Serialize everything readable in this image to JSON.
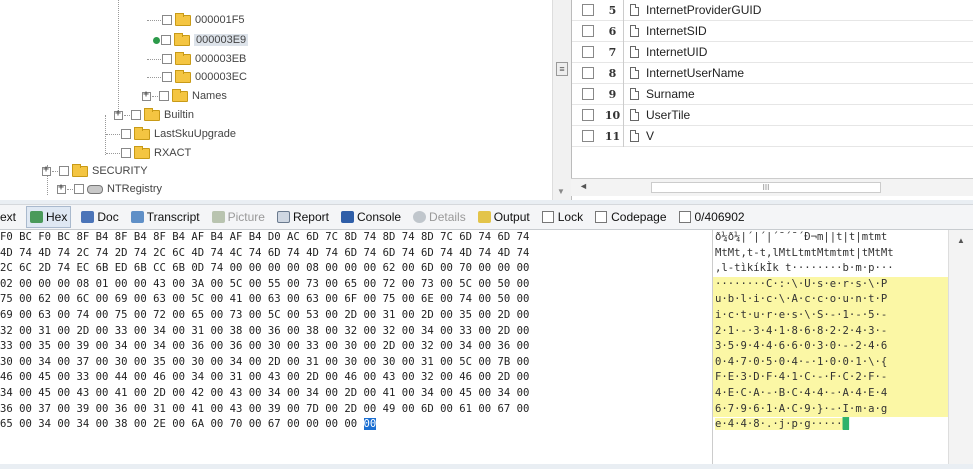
{
  "tree": {
    "items": [
      {
        "label": "000001F5",
        "selected": false
      },
      {
        "label": "000003E9",
        "selected": true
      },
      {
        "label": "000003EB",
        "selected": false
      },
      {
        "label": "000003EC",
        "selected": false
      },
      {
        "label": "Names",
        "selected": false
      },
      {
        "label": "Builtin",
        "selected": false
      },
      {
        "label": "LastSkuUpgrade",
        "selected": false
      },
      {
        "label": "RXACT",
        "selected": false
      },
      {
        "label": "SECURITY",
        "selected": false
      },
      {
        "label": "NTRegistry",
        "selected": false
      }
    ]
  },
  "list": {
    "rows": [
      {
        "num": "5",
        "name": "InternetProviderGUID"
      },
      {
        "num": "6",
        "name": "InternetSID"
      },
      {
        "num": "7",
        "name": "InternetUID"
      },
      {
        "num": "8",
        "name": "InternetUserName"
      },
      {
        "num": "9",
        "name": "Surname"
      },
      {
        "num": "10",
        "name": "UserTile"
      },
      {
        "num": "11",
        "name": "V"
      }
    ]
  },
  "toolbar": {
    "text_label": "ext",
    "hex_label": "Hex",
    "doc_label": "Doc",
    "transcript_label": "Transcript",
    "picture_label": "Picture",
    "report_label": "Report",
    "console_label": "Console",
    "details_label": "Details",
    "output_label": "Output",
    "lock_label": "Lock",
    "codepage_label": "Codepage",
    "position_label": "0/406902"
  },
  "hex": {
    "lines": [
      "F0 BC F0 BC 8F B4 8F B4 8F B4 AF B4 AF B4 D0 AC 6D 7C 8D 74 8D 74 8D 7C 6D 74 6D 74",
      "4D 74 4D 74 2C 74 2D 74 2C 6C 4D 74 4C 74 6D 74 4D 74 6D 74 6D 74 6D 74 4D 74 4D 74",
      "2C 6C 2D 74 EC 6B ED 6B CC 6B 0D 74 00 00 00 00 08 00 00 00 62 00 6D 00 70 00 00 00",
      "02 00 00 00 08 01 00 00 43 00 3A 00 5C 00 55 00 73 00 65 00 72 00 73 00 5C 00 50 00",
      "75 00 62 00 6C 00 69 00 63 00 5C 00 41 00 63 00 63 00 6F 00 75 00 6E 00 74 00 50 00",
      "69 00 63 00 74 00 75 00 72 00 65 00 73 00 5C 00 53 00 2D 00 31 00 2D 00 35 00 2D 00",
      "32 00 31 00 2D 00 33 00 34 00 31 00 38 00 36 00 38 00 32 00 32 00 34 00 33 00 2D 00",
      "33 00 35 00 39 00 34 00 34 00 36 00 36 00 30 00 33 00 30 00 2D 00 32 00 34 00 36 00",
      "30 00 34 00 37 00 30 00 35 00 30 00 34 00 2D 00 31 00 30 00 30 00 31 00 5C 00 7B 00",
      "46 00 45 00 33 00 44 00 46 00 34 00 31 00 43 00 2D 00 46 00 43 00 32 00 46 00 2D 00",
      "34 00 45 00 43 00 41 00 2D 00 42 00 43 00 34 00 34 00 2D 00 41 00 34 00 45 00 34 00",
      "36 00 37 00 39 00 36 00 31 00 41 00 43 00 39 00 7D 00 2D 00 49 00 6D 00 61 00 67 00",
      "65 00 34 00 34 00 38 00 2E 00 6A 00 70 00 67 00 00 00 00 "
    ],
    "selected_byte": "00"
  },
  "ascii": {
    "lines": [
      "ð¼ð¼|´|´|´¯´¯´Ð¬m||t|t|mtmt",
      "MtMt,t-t,lMtLtmtMtmtmt|tMtMt",
      ",l-tìkíkÌk t········b·m·p···",
      "········C·:·\\·U·s·e·r·s·\\·P",
      "u·b·l·i·c·\\·A·c·c·o·u·n·t·P",
      "i·c·t·u·r·e·s·\\·S·-·1·-·5·-",
      "2·1·-·3·4·1·8·6·8·2·2·4·3·-",
      "3·5·9·4·4·6·6·0·3·0·-·2·4·6",
      "0·4·7·0·5·0·4·-·1·0·0·1·\\·{",
      "F·E·3·D·F·4·1·C·-·F·C·2·F·-",
      "4·E·C·A·-·B·C·4·4·-·A·4·E·4",
      "6·7·9·6·1·A·C·9·}·-·I·m·a·g",
      "e·4·4·8·.·j·p·g·····"
    ]
  },
  "scroll": {
    "grip_label": "≡",
    "hscroll_thumb_label": "III"
  }
}
